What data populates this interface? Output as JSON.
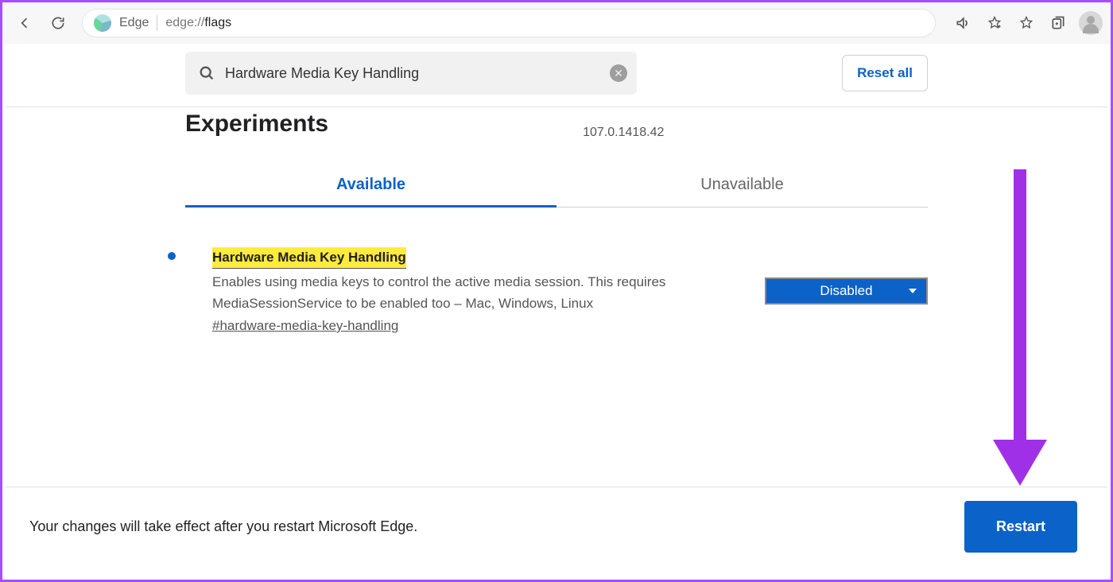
{
  "browser": {
    "label": "Edge",
    "url_prefix": "edge://",
    "url_path": "flags"
  },
  "search": {
    "value": "Hardware Media Key Handling"
  },
  "reset_label": "Reset all",
  "page_title": "Experiments",
  "version": "107.0.1418.42",
  "tabs": {
    "available": "Available",
    "unavailable": "Unavailable"
  },
  "flag": {
    "title": "Hardware Media Key Handling",
    "description": "Enables using media keys to control the active media session. This requires MediaSessionService to be enabled too – Mac, Windows, Linux",
    "hash": "#hardware-media-key-handling",
    "state": "Disabled"
  },
  "footer": {
    "message": "Your changes will take effect after you restart Microsoft Edge.",
    "restart": "Restart"
  }
}
